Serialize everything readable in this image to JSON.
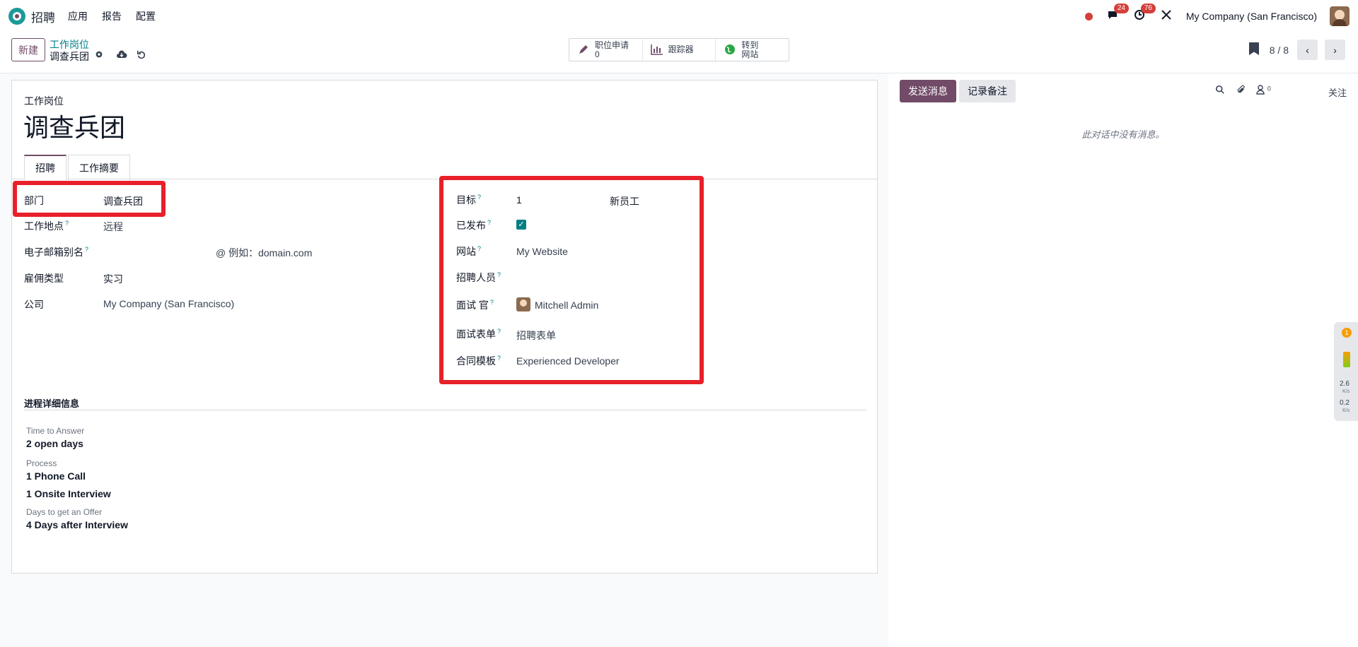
{
  "navbar": {
    "app_name": "招聘",
    "menu": [
      "应用",
      "报告",
      "配置"
    ],
    "chat_badge": "24",
    "activity_badge": "76",
    "company": "My Company (San Francisco)"
  },
  "control": {
    "new_label": "新建",
    "breadcrumb_parent": "工作岗位",
    "breadcrumb_current": "调查兵团",
    "smart_buttons": [
      {
        "icon": "pencil-icon",
        "line1": "职位申请",
        "line2": "0"
      },
      {
        "icon": "bar-chart-icon",
        "line1": "跟踪器",
        "line2": ""
      },
      {
        "icon": "globe-icon",
        "line1": "转到",
        "line2": "网站"
      }
    ],
    "pager": "8 / 8"
  },
  "form": {
    "record_label": "工作岗位",
    "title": "调查兵团",
    "tabs": [
      "招聘",
      "工作摘要"
    ],
    "left_fields": {
      "department": {
        "label": "部门",
        "value": "调查兵团"
      },
      "location": {
        "label": "工作地点",
        "value": "远程"
      },
      "email_alias": {
        "label": "电子邮箱别名",
        "value": "@ 例如：domain.com"
      },
      "employment_type": {
        "label": "雇佣类型",
        "value": "实习"
      },
      "company": {
        "label": "公司",
        "value": "My Company (San Francisco)"
      }
    },
    "right_fields": {
      "target": {
        "label": "目标",
        "value": "1",
        "unit": "新员工"
      },
      "published": {
        "label": "已发布",
        "checked": true
      },
      "website": {
        "label": "网站",
        "value": "My Website"
      },
      "recruiter": {
        "label": "招聘人员",
        "value": ""
      },
      "interviewer": {
        "label": "面试 官",
        "value": "Mitchell Admin"
      },
      "interview_form": {
        "label": "面试表单",
        "value": "招聘表单"
      },
      "contract_template": {
        "label": "合同模板",
        "value": "Experienced Developer"
      }
    },
    "process_section": {
      "title": "进程详细信息",
      "time_label": "Time to Answer",
      "time_value": "2 open days",
      "process_label": "Process",
      "process_step1": "1 Phone Call",
      "process_step2": "1 Onsite Interview",
      "offer_label": "Days to get an Offer",
      "offer_value": "4 Days after Interview"
    }
  },
  "chatter": {
    "send_label": "发送消息",
    "note_label": "记录备注",
    "followers_count": "0",
    "follow_label": "关注",
    "empty_text": "此对话中没有消息。"
  },
  "widget": {
    "badge": "1",
    "up_value": "2.6",
    "up_unit": "K/s",
    "down_value": "0.2",
    "down_unit": "K/s"
  },
  "colors": {
    "brand": "#714b67",
    "link": "#017e84",
    "highlight": "#e8202a",
    "badge": "#d43f3a"
  }
}
